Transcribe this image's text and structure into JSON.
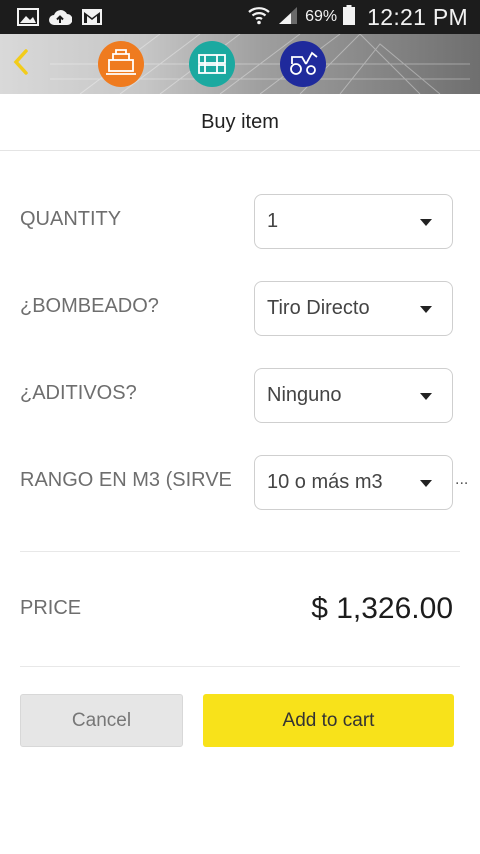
{
  "status_bar": {
    "battery_percent": "69%",
    "time": "12:21 PM",
    "icons": [
      "image-icon",
      "cloud-upload-icon",
      "gmail-icon",
      "wifi-icon",
      "signal-icon",
      "battery-icon"
    ]
  },
  "header": {
    "back_icon": "chevron-left-icon",
    "categories": [
      {
        "icon": "concrete-mixer-icon",
        "color": "#ef7b1f"
      },
      {
        "icon": "materials-icon",
        "color": "#1ba9a0"
      },
      {
        "icon": "machinery-icon",
        "color": "#1f2a9c"
      }
    ]
  },
  "page": {
    "title": "Buy item"
  },
  "form": {
    "rows": [
      {
        "label": "QUANTITY",
        "value": "1"
      },
      {
        "label": "¿BOMBEADO?",
        "value": "Tiro Directo"
      },
      {
        "label": "¿ADITIVOS?",
        "value": "Ninguno"
      },
      {
        "label": "RANGO EN M3 (SIRVE",
        "value": "10 o más m3"
      }
    ],
    "overflow": "..."
  },
  "price": {
    "label": "PRICE",
    "value": "$ 1,326.00"
  },
  "actions": {
    "cancel_label": "Cancel",
    "add_label": "Add to cart"
  },
  "colors": {
    "accent_yellow": "#f8e21a",
    "back_arrow": "#f2cc1a"
  }
}
